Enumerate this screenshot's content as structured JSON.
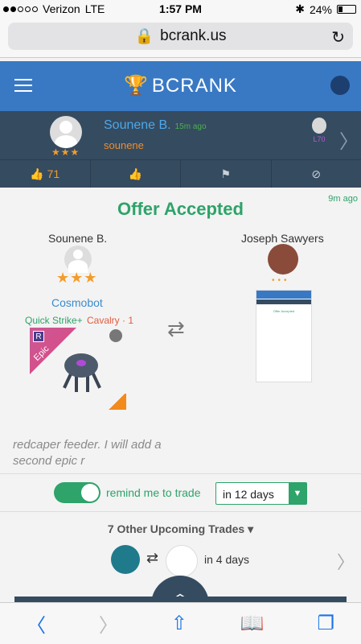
{
  "status_bar": {
    "carrier": "Verizon",
    "network": "LTE",
    "time": "1:57 PM",
    "battery": "24%"
  },
  "browser": {
    "url": "bcrank.us"
  },
  "header": {
    "logo": "BCRANK"
  },
  "user": {
    "name": "Sounene B.",
    "time": "15m ago",
    "handle": "sounene",
    "level": "L70"
  },
  "actions": {
    "likes": "71"
  },
  "offer": {
    "ago": "9m ago",
    "title": "Offer Accepted",
    "left_user": "Sounene B.",
    "right_user": "Joseph Sawyers",
    "bot_name": "Cosmobot",
    "ability": "Quick Strike+",
    "type_level": "Cavalry · 1",
    "rarity": "Epic",
    "rarity_badge": "R",
    "note": "redcaper feeder. I will add a second epic r",
    "thumb_title": "Offer Accepted"
  },
  "remind": {
    "label": "remind me to trade",
    "selected": "in 12 days"
  },
  "upcoming": {
    "title": "7 Other Upcoming Trades",
    "row_days": "in 4 days"
  }
}
